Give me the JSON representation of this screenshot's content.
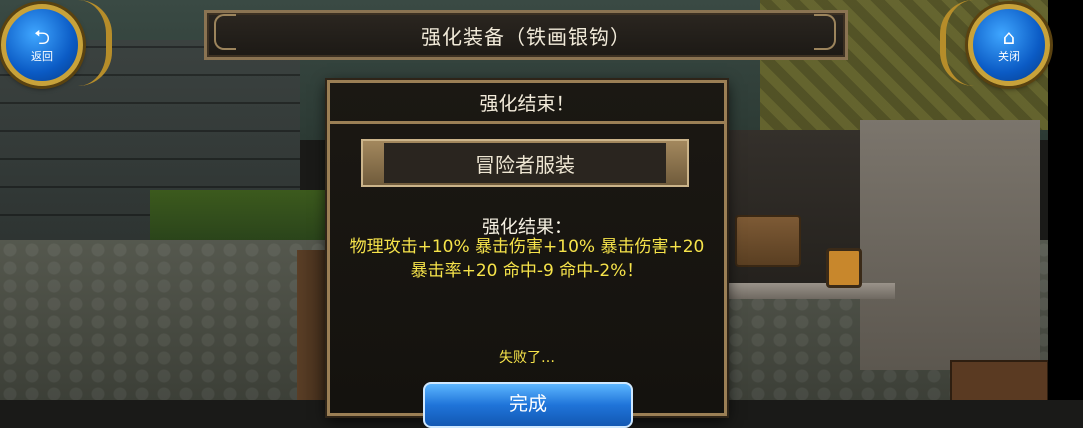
{
  "header": {
    "title": "强化装备（铁画银钩）",
    "back_label": "返回",
    "back_icon": "return-arrow-icon",
    "close_label": "关闭",
    "close_icon": "home-icon"
  },
  "dialog": {
    "title": "强化结束！",
    "item_name": "冒险者服装",
    "result_heading": "强化结果：",
    "result_detail": "物理攻击+10% 暴击伤害+10% 暴击伤害+20 暴击率+20 命中-9 命中-2%！",
    "status_text": "失败了…",
    "confirm_label": "完成"
  },
  "colors": {
    "highlight_text": "#f6e34a",
    "button_blue": "#1f74d9",
    "frame_gold": "#9b7f55"
  }
}
